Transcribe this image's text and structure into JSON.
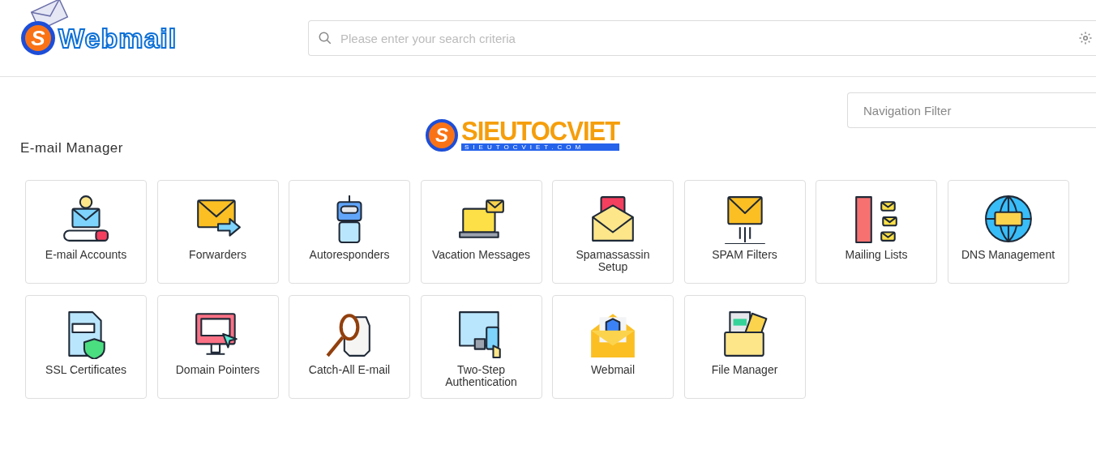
{
  "header": {
    "logo": {
      "badge": "S",
      "text": "Webmail"
    },
    "search": {
      "placeholder": "Please enter your search criteria"
    }
  },
  "brand": {
    "badge": "S",
    "name": "SIEUTOCVIET",
    "domain": "SIEUTOCVIET.COM"
  },
  "navigation_filter": {
    "placeholder": "Navigation Filter"
  },
  "section": {
    "title": "E-mail Manager",
    "tiles": [
      {
        "label": "E-mail Accounts",
        "kind": "account"
      },
      {
        "label": "Forwarders",
        "kind": "forward"
      },
      {
        "label": "Autoresponders",
        "kind": "robot"
      },
      {
        "label": "Vacation Messages",
        "kind": "vacation"
      },
      {
        "label": "Spamassassin Setup",
        "kind": "spam"
      },
      {
        "label": "SPAM Filters",
        "kind": "filter"
      },
      {
        "label": "Mailing Lists",
        "kind": "lists"
      },
      {
        "label": "DNS Management",
        "kind": "dns"
      },
      {
        "label": "SSL Certificates",
        "kind": "ssl"
      },
      {
        "label": "Domain Pointers",
        "kind": "domain"
      },
      {
        "label": "Catch-All E-mail",
        "kind": "catch"
      },
      {
        "label": "Two-Step Authentication",
        "kind": "twostep"
      },
      {
        "label": "Webmail",
        "kind": "webmail"
      },
      {
        "label": "File Manager",
        "kind": "files"
      }
    ]
  }
}
